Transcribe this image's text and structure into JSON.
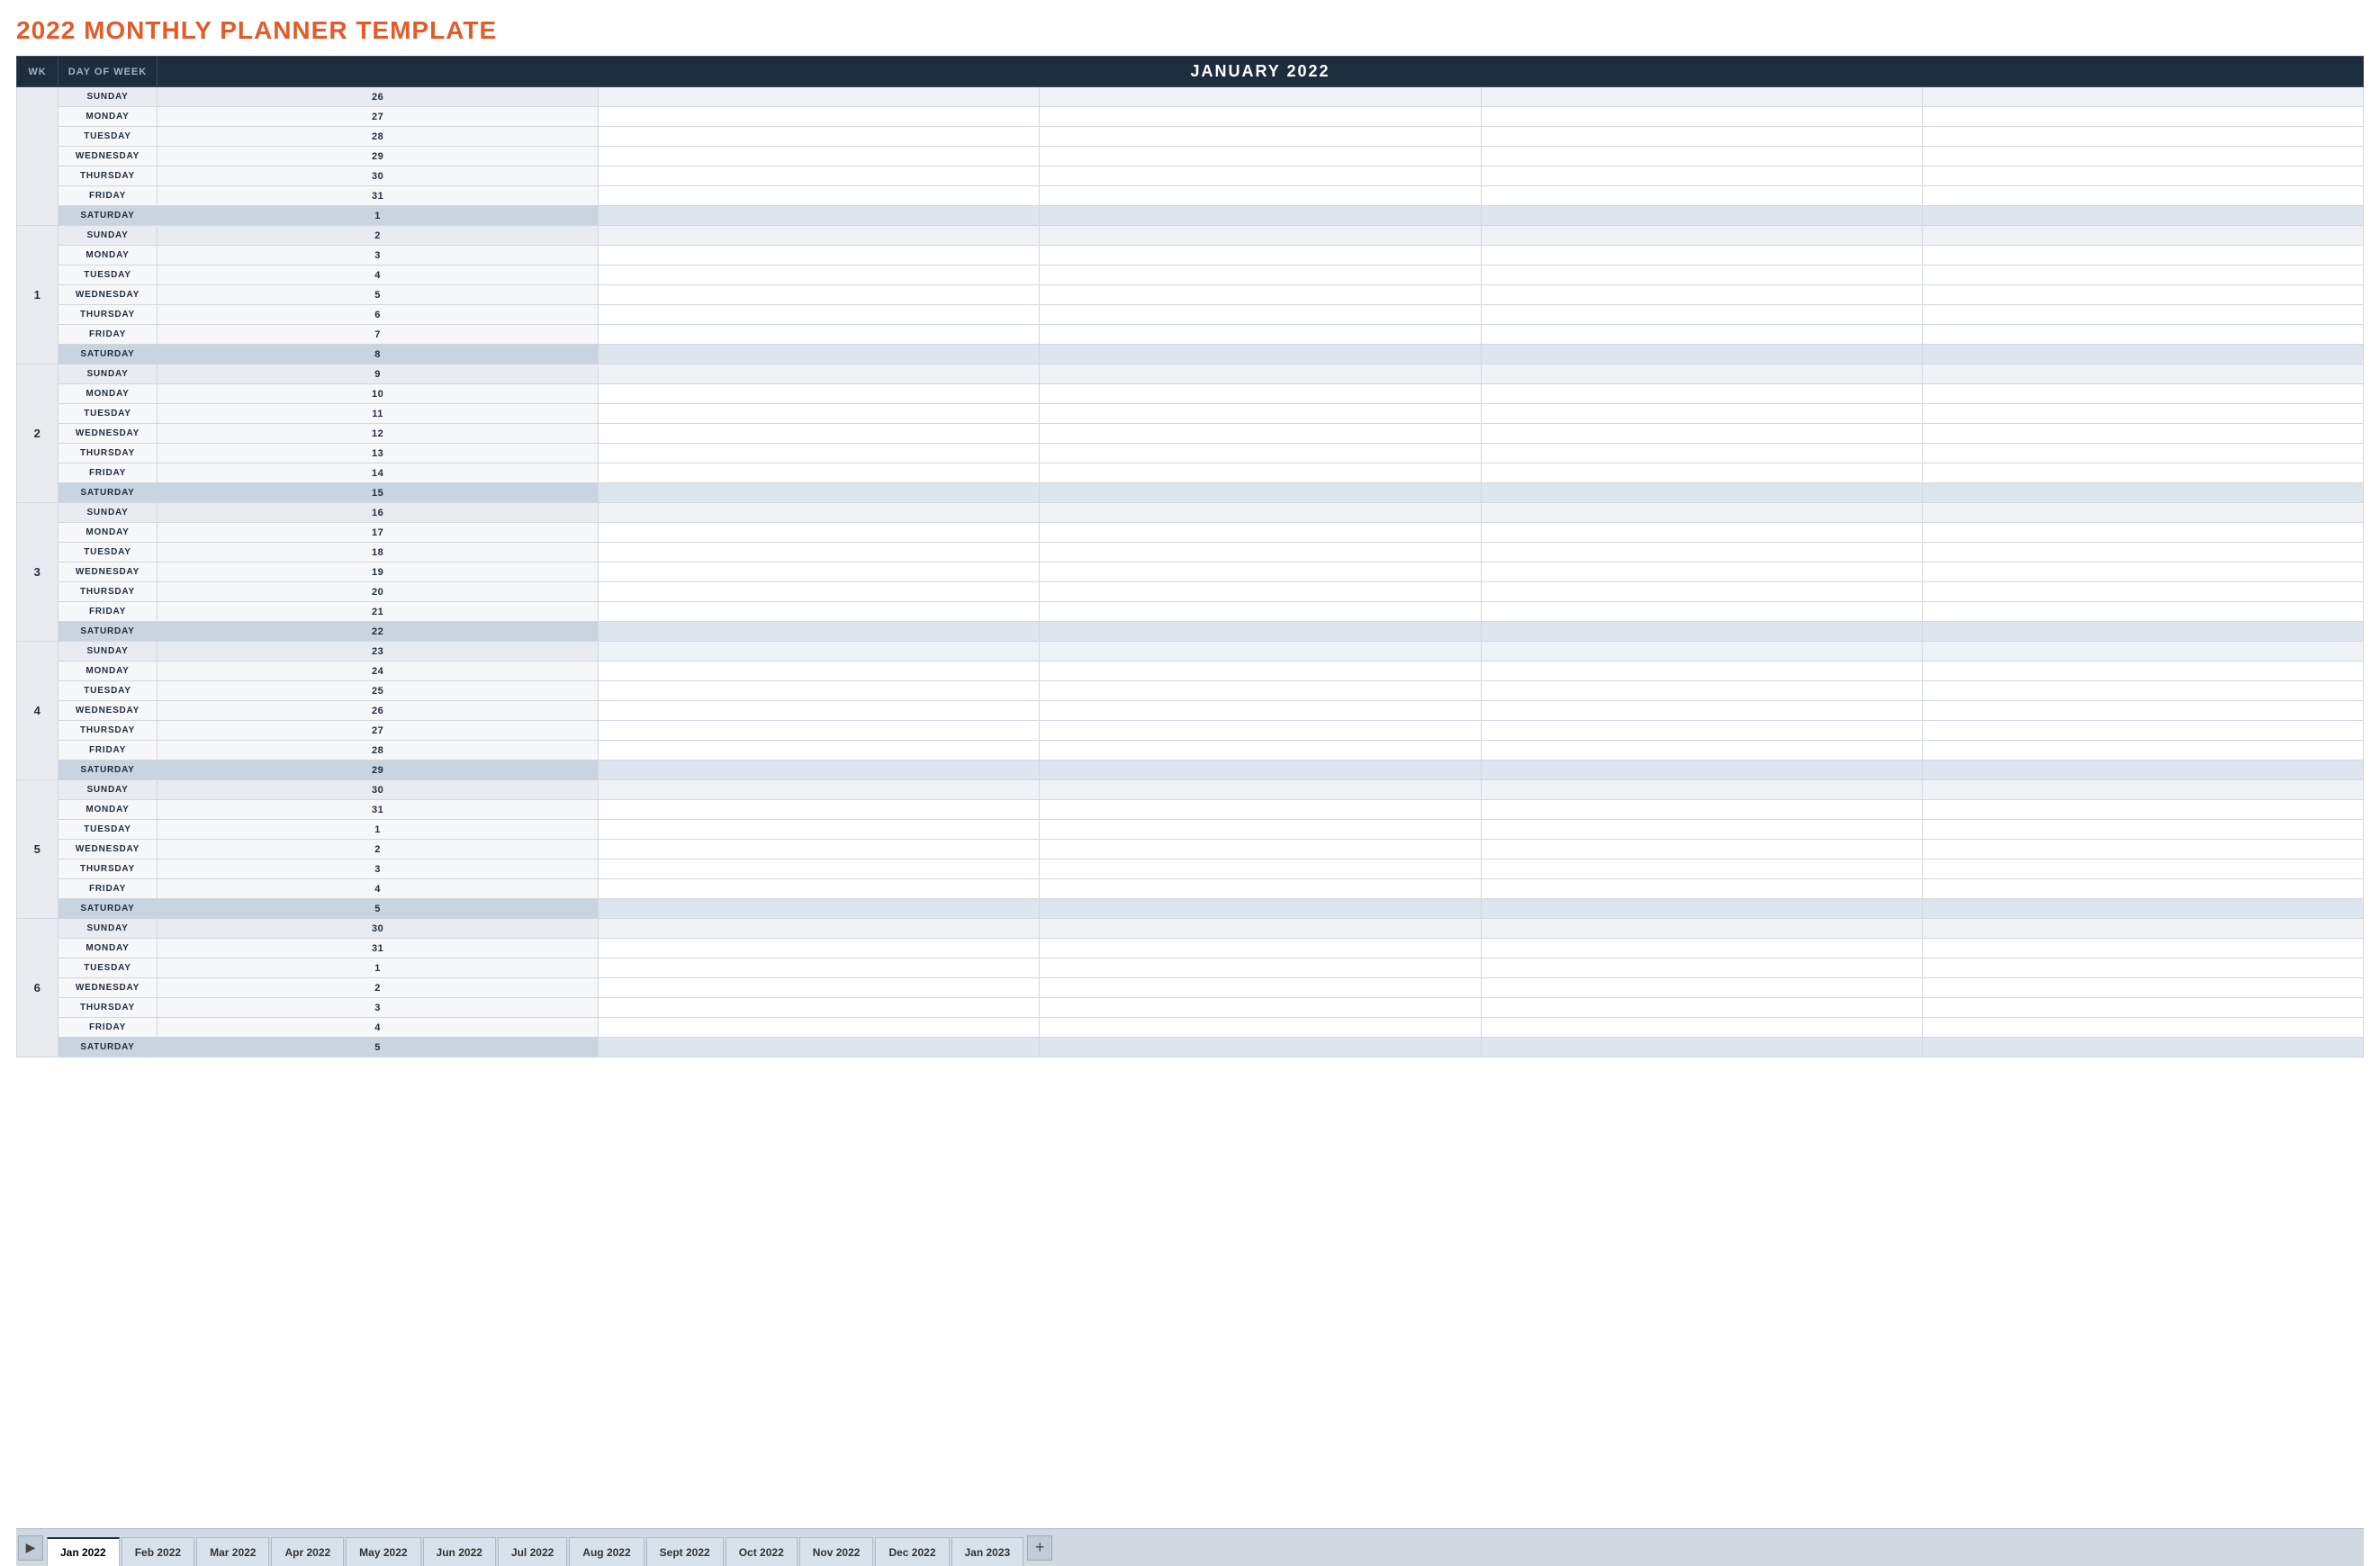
{
  "title": "2022 MONTHLY PLANNER TEMPLATE",
  "header": {
    "col_wk": "WK",
    "col_dow": "DAY OF WEEK",
    "month_label": "JANUARY 2022"
  },
  "weeks": [
    {
      "wk": "",
      "days": [
        {
          "dow": "SUNDAY",
          "date": "26",
          "type": "sunday"
        },
        {
          "dow": "MONDAY",
          "date": "27",
          "type": "weekday"
        },
        {
          "dow": "TUESDAY",
          "date": "28",
          "type": "weekday"
        },
        {
          "dow": "WEDNESDAY",
          "date": "29",
          "type": "weekday"
        },
        {
          "dow": "THURSDAY",
          "date": "30",
          "type": "weekday"
        },
        {
          "dow": "FRIDAY",
          "date": "31",
          "type": "weekday"
        },
        {
          "dow": "SATURDAY",
          "date": "1",
          "type": "saturday"
        }
      ]
    },
    {
      "wk": "1",
      "days": [
        {
          "dow": "SUNDAY",
          "date": "2",
          "type": "sunday"
        },
        {
          "dow": "MONDAY",
          "date": "3",
          "type": "weekday"
        },
        {
          "dow": "TUESDAY",
          "date": "4",
          "type": "weekday"
        },
        {
          "dow": "WEDNESDAY",
          "date": "5",
          "type": "weekday"
        },
        {
          "dow": "THURSDAY",
          "date": "6",
          "type": "weekday"
        },
        {
          "dow": "FRIDAY",
          "date": "7",
          "type": "weekday"
        },
        {
          "dow": "SATURDAY",
          "date": "8",
          "type": "saturday"
        }
      ]
    },
    {
      "wk": "2",
      "days": [
        {
          "dow": "SUNDAY",
          "date": "9",
          "type": "sunday"
        },
        {
          "dow": "MONDAY",
          "date": "10",
          "type": "weekday"
        },
        {
          "dow": "TUESDAY",
          "date": "11",
          "type": "weekday"
        },
        {
          "dow": "WEDNESDAY",
          "date": "12",
          "type": "weekday"
        },
        {
          "dow": "THURSDAY",
          "date": "13",
          "type": "weekday"
        },
        {
          "dow": "FRIDAY",
          "date": "14",
          "type": "weekday"
        },
        {
          "dow": "SATURDAY",
          "date": "15",
          "type": "saturday"
        }
      ]
    },
    {
      "wk": "3",
      "days": [
        {
          "dow": "SUNDAY",
          "date": "16",
          "type": "sunday"
        },
        {
          "dow": "MONDAY",
          "date": "17",
          "type": "weekday"
        },
        {
          "dow": "TUESDAY",
          "date": "18",
          "type": "weekday"
        },
        {
          "dow": "WEDNESDAY",
          "date": "19",
          "type": "weekday"
        },
        {
          "dow": "THURSDAY",
          "date": "20",
          "type": "weekday"
        },
        {
          "dow": "FRIDAY",
          "date": "21",
          "type": "weekday"
        },
        {
          "dow": "SATURDAY",
          "date": "22",
          "type": "saturday"
        }
      ]
    },
    {
      "wk": "4",
      "days": [
        {
          "dow": "SUNDAY",
          "date": "23",
          "type": "sunday"
        },
        {
          "dow": "MONDAY",
          "date": "24",
          "type": "weekday"
        },
        {
          "dow": "TUESDAY",
          "date": "25",
          "type": "weekday"
        },
        {
          "dow": "WEDNESDAY",
          "date": "26",
          "type": "weekday"
        },
        {
          "dow": "THURSDAY",
          "date": "27",
          "type": "weekday"
        },
        {
          "dow": "FRIDAY",
          "date": "28",
          "type": "weekday"
        },
        {
          "dow": "SATURDAY",
          "date": "29",
          "type": "saturday"
        }
      ]
    },
    {
      "wk": "5",
      "days": [
        {
          "dow": "SUNDAY",
          "date": "30",
          "type": "sunday"
        },
        {
          "dow": "MONDAY",
          "date": "31",
          "type": "weekday"
        },
        {
          "dow": "TUESDAY",
          "date": "1",
          "type": "weekday"
        },
        {
          "dow": "WEDNESDAY",
          "date": "2",
          "type": "weekday"
        },
        {
          "dow": "THURSDAY",
          "date": "3",
          "type": "weekday"
        },
        {
          "dow": "FRIDAY",
          "date": "4",
          "type": "weekday"
        },
        {
          "dow": "SATURDAY",
          "date": "5",
          "type": "saturday"
        }
      ]
    },
    {
      "wk": "6",
      "days": [
        {
          "dow": "SUNDAY",
          "date": "30",
          "type": "sunday"
        },
        {
          "dow": "MONDAY",
          "date": "31",
          "type": "weekday"
        },
        {
          "dow": "TUESDAY",
          "date": "1",
          "type": "weekday"
        },
        {
          "dow": "WEDNESDAY",
          "date": "2",
          "type": "weekday"
        },
        {
          "dow": "THURSDAY",
          "date": "3",
          "type": "weekday"
        },
        {
          "dow": "FRIDAY",
          "date": "4",
          "type": "weekday"
        },
        {
          "dow": "SATURDAY",
          "date": "5",
          "type": "saturday"
        }
      ]
    }
  ],
  "tabs": [
    {
      "label": "Jan 2022",
      "active": true
    },
    {
      "label": "Feb 2022",
      "active": false
    },
    {
      "label": "Mar 2022",
      "active": false
    },
    {
      "label": "Apr 2022",
      "active": false
    },
    {
      "label": "May 2022",
      "active": false
    },
    {
      "label": "Jun 2022",
      "active": false
    },
    {
      "label": "Jul 2022",
      "active": false
    },
    {
      "label": "Aug 2022",
      "active": false
    },
    {
      "label": "Sept 2022",
      "active": false
    },
    {
      "label": "Oct 2022",
      "active": false
    },
    {
      "label": "Nov 2022",
      "active": false
    },
    {
      "label": "Dec 2022",
      "active": false
    },
    {
      "label": "Jan 2023",
      "active": false
    }
  ]
}
